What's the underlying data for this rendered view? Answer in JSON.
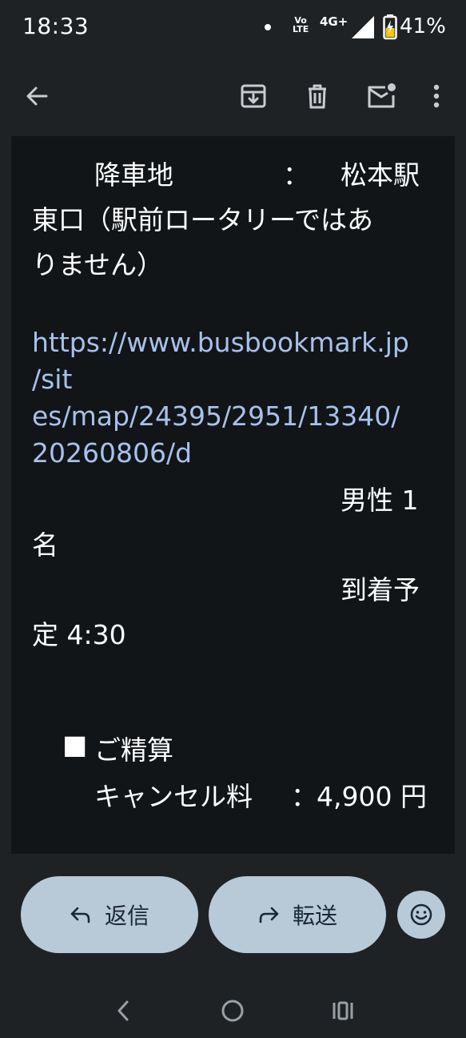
{
  "status": {
    "time": "18:33",
    "volte": [
      "Vo",
      "LTE"
    ],
    "network": "4G+",
    "battery": "41%"
  },
  "toolbar": {
    "back_icon": "arrow-back-icon",
    "archive_icon": "archive-icon",
    "delete_icon": "trash-icon",
    "unread_icon": "mark-unread-icon",
    "more_icon": "more-vert-icon"
  },
  "mail": {
    "line1_label": "降車地",
    "line1_colon": "：",
    "line1_value": "松本駅",
    "line2": "東口（駅前ロータリーではあ",
    "line3": "りません）",
    "url_line1": "https://www.busbookmark.jp",
    "url_line2": "/sit",
    "url_line3": "es/map/24395/2951/13340/",
    "url_line4": "20260806/d",
    "gender_a": "男性 1",
    "gender_b": "名",
    "arrival_a": "到着予",
    "arrival_b": "定 4:30",
    "section_marker": "■",
    "section_title": "ご精算",
    "fee_label": "キャンセル料",
    "fee_colon": "：",
    "fee_value": "4,900 円"
  },
  "actions": {
    "reply_label": "返信",
    "forward_label": "転送",
    "emoji_icon": "emoji-smile-icon"
  },
  "colors": {
    "background": "#1f2224",
    "content_bg": "#111518",
    "link": "#a8c1ea",
    "button": "#b8cad8"
  }
}
